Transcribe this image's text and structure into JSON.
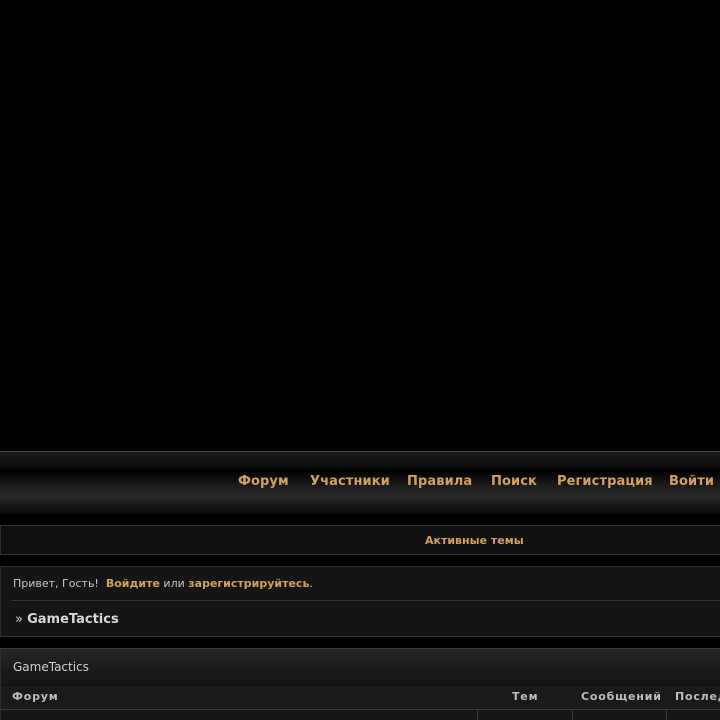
{
  "nav": {
    "items": [
      {
        "label": "Форум"
      },
      {
        "label": "Участники"
      },
      {
        "label": "Правила"
      },
      {
        "label": "Поиск"
      },
      {
        "label": "Регистрация"
      },
      {
        "label": "Войти"
      }
    ]
  },
  "active_topics": {
    "label": "Активные темы"
  },
  "welcome": {
    "greeting": "Привет, Гость!",
    "login_link": "Войдите",
    "or_text": "или",
    "register_link": "зарегистрируйтесь",
    "end": "."
  },
  "breadcrumb": {
    "arrow": "»",
    "current": "GameTactics"
  },
  "category": {
    "title": "GameTactics",
    "columns": [
      "Форум",
      "Тем",
      "Сообщений",
      "Последнее сообщение"
    ]
  },
  "colors": {
    "accent": "#d3a062",
    "background": "#000000"
  }
}
